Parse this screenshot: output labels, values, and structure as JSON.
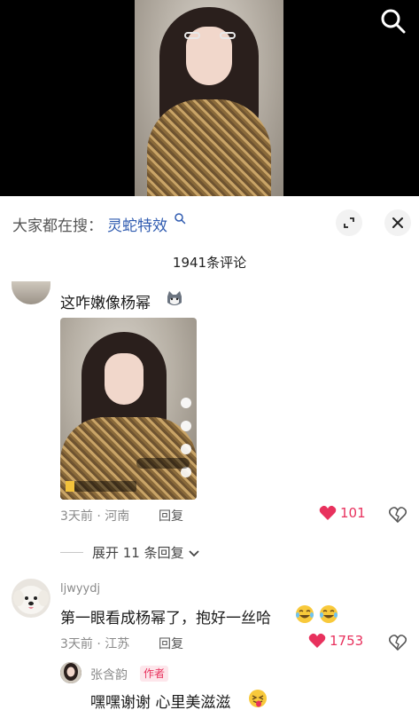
{
  "video": {
    "search_icon": "search-icon"
  },
  "suggest": {
    "prefix": "大家都在搜：",
    "term": "灵蛇特效",
    "query_icon": "search-icon",
    "expand_icon": "expand-icon",
    "close_icon": "close-icon"
  },
  "comments_header": {
    "count_text": "1941条评论"
  },
  "comments": [
    {
      "text": "这咋嫩像杨幂",
      "emoji": "cat-emoji",
      "meta": "3天前 · 河南",
      "reply_label": "回复",
      "like_count": "101",
      "expand_replies": "展开 11 条回复"
    },
    {
      "username": "ljwyydj",
      "text": "第一眼看成杨幂了，抱好一丝哈",
      "emoji": "laughing-tears-emoji",
      "meta": "3天前 · 江苏",
      "reply_label": "回复",
      "like_count": "1753",
      "reply": {
        "username": "张含韵",
        "badge": "作者",
        "text": "嘿嘿谢谢 心里美滋滋",
        "emoji": "tongue-out-emoji"
      }
    }
  ],
  "colors": {
    "like_red": "#e8315d",
    "link_blue": "#2f5bb0",
    "meta_gray": "#8a8a8a"
  }
}
